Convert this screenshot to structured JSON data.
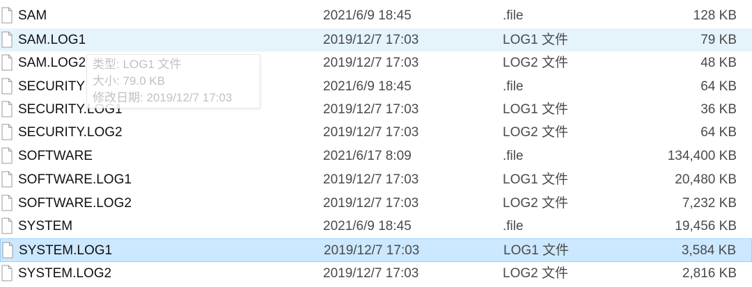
{
  "files": [
    {
      "name": "SAM",
      "date": "2021/6/9 18:45",
      "type": ".file",
      "size": "128 KB",
      "state": "normal"
    },
    {
      "name": "SAM.LOG1",
      "date": "2019/12/7 17:03",
      "type": "LOG1 文件",
      "size": "79 KB",
      "state": "hover"
    },
    {
      "name": "SAM.LOG2",
      "date": "2019/12/7 17:03",
      "type": "LOG2 文件",
      "size": "48 KB",
      "state": "normal"
    },
    {
      "name": "SECURITY",
      "date": "2021/6/9 18:45",
      "type": ".file",
      "size": "64 KB",
      "state": "normal"
    },
    {
      "name": "SECURITY.LOG1",
      "date": "2019/12/7 17:03",
      "type": "LOG1 文件",
      "size": "36 KB",
      "state": "normal"
    },
    {
      "name": "SECURITY.LOG2",
      "date": "2019/12/7 17:03",
      "type": "LOG2 文件",
      "size": "64 KB",
      "state": "normal"
    },
    {
      "name": "SOFTWARE",
      "date": "2021/6/17 8:09",
      "type": ".file",
      "size": "134,400 KB",
      "state": "normal"
    },
    {
      "name": "SOFTWARE.LOG1",
      "date": "2019/12/7 17:03",
      "type": "LOG1 文件",
      "size": "20,480 KB",
      "state": "normal"
    },
    {
      "name": "SOFTWARE.LOG2",
      "date": "2019/12/7 17:03",
      "type": "LOG2 文件",
      "size": "7,232 KB",
      "state": "normal"
    },
    {
      "name": "SYSTEM",
      "date": "2021/6/9 18:45",
      "type": ".file",
      "size": "19,456 KB",
      "state": "normal"
    },
    {
      "name": "SYSTEM.LOG1",
      "date": "2019/12/7 17:03",
      "type": "LOG1 文件",
      "size": "3,584 KB",
      "state": "selected"
    },
    {
      "name": "SYSTEM.LOG2",
      "date": "2019/12/7 17:03",
      "type": "LOG2 文件",
      "size": "2,816 KB",
      "state": "normal"
    }
  ],
  "tooltip": {
    "type_line": "类型: LOG1 文件",
    "size_line": "大小: 79.0 KB",
    "modified_line": "修改日期: 2019/12/7 17:03"
  },
  "icons": {
    "row_icon": "file-icon"
  },
  "colors": {
    "hover_bg": "#e5f3fb",
    "selected_bg": "#cce8ff",
    "selected_border": "#99d1ff"
  }
}
